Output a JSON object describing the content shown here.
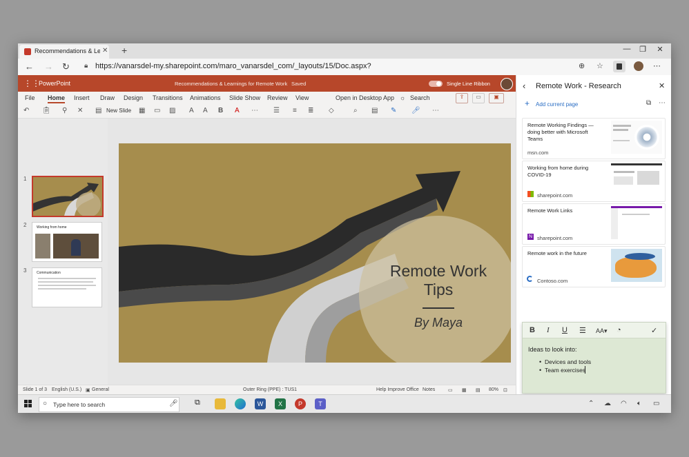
{
  "browser": {
    "tab_title": "Recommendations & Learnings f",
    "new_tab": "+",
    "url": "https://vanarsdel-my.sharepoint.com/maro_vanarsdel_com/_layouts/15/Doc.aspx?"
  },
  "ppt": {
    "app_name": "PowerPoint",
    "doc_title": "Recommendations & Learnings for Remote Work",
    "saved": "Saved",
    "single_line_ribbon": "Single Line Ribbon",
    "tabs": [
      "File",
      "Home",
      "Insert",
      "Draw",
      "Design",
      "Transitions",
      "Animations",
      "Slide Show",
      "Review",
      "View"
    ],
    "open_desktop": "Open in Desktop App",
    "search": "Search",
    "new_slide": "New Slide",
    "thumbnails": [
      {
        "num": "1"
      },
      {
        "num": "2",
        "title": "Working from home"
      },
      {
        "num": "3",
        "title": "Communication"
      }
    ],
    "slide": {
      "title": "Remote Work Tips",
      "subtitle": "By Maya"
    },
    "status": {
      "slide_of": "Slide 1 of 3",
      "language": "English (U.S.)",
      "sensitivity": "General",
      "ring": "Outer Ring (PPE) : TUS1",
      "help": "Help Improve Office",
      "notes": "Notes",
      "zoom": "80%"
    }
  },
  "panel": {
    "title": "Remote Work - Research",
    "add_page": "Add current page",
    "cards": [
      {
        "title": "Remote Working Findings — doing better with Microsoft Teams",
        "source": "msn.com"
      },
      {
        "title": "Working from home during COVID-19",
        "source": "sharepoint.com"
      },
      {
        "title": "Remote Work Links",
        "source": "sharepoint.com"
      },
      {
        "title": "Remote work in the future",
        "source": "Contoso.com"
      }
    ],
    "note": {
      "heading": "Ideas to look into:",
      "bullets": [
        "Devices and tools",
        "Team exercises"
      ]
    }
  },
  "taskbar": {
    "search_placeholder": "Type here to search"
  },
  "colors": {
    "ppt_red": "#b7472a",
    "slide_gold": "#a68d4d",
    "note_green": "#dde8d4"
  }
}
